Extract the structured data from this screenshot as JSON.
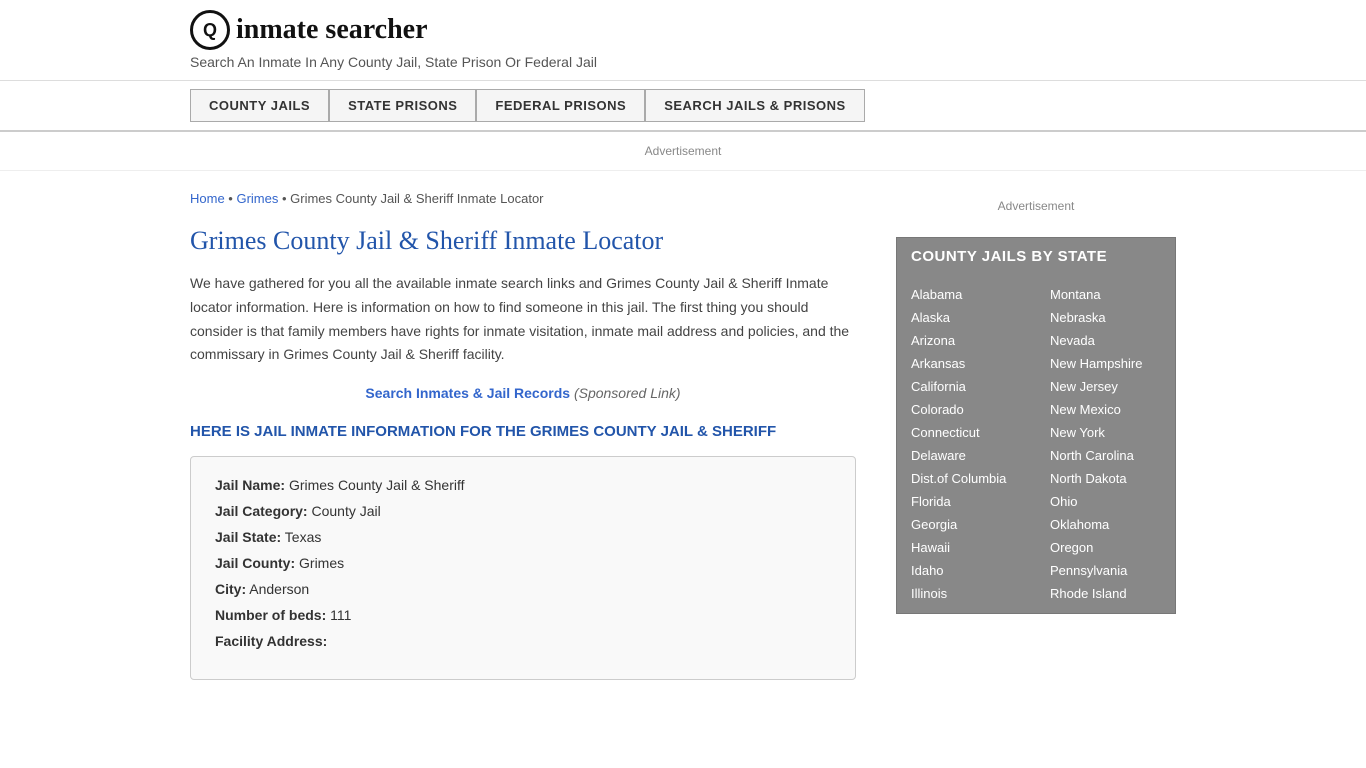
{
  "header": {
    "logo_icon": "🔍",
    "logo_text": "inmate searcher",
    "logo_prefix": "Q",
    "tagline": "Search An Inmate In Any County Jail, State Prison Or Federal Jail"
  },
  "nav": {
    "buttons": [
      {
        "label": "COUNTY JAILS",
        "name": "county-jails-nav"
      },
      {
        "label": "STATE PRISONS",
        "name": "state-prisons-nav"
      },
      {
        "label": "FEDERAL PRISONS",
        "name": "federal-prisons-nav"
      },
      {
        "label": "SEARCH JAILS & PRISONS",
        "name": "search-jails-nav"
      }
    ]
  },
  "ad_top": "Advertisement",
  "breadcrumb": {
    "home": "Home",
    "grimes": "Grimes",
    "current": "Grimes County Jail & Sheriff Inmate Locator"
  },
  "page_title": "Grimes County Jail & Sheriff Inmate Locator",
  "description": "We have gathered for you all the available inmate search links and Grimes County Jail & Sheriff Inmate locator information. Here is information on how to find someone in this jail. The first thing you should consider is that family members have rights for inmate visitation, inmate mail address and policies, and the commissary in Grimes County Jail & Sheriff facility.",
  "search_link": {
    "text": "Search Inmates & Jail Records",
    "sponsored": "(Sponsored Link)"
  },
  "jail_info_heading": "HERE IS JAIL INMATE INFORMATION FOR THE GRIMES COUNTY JAIL & SHERIFF",
  "jail_info": {
    "name_label": "Jail Name:",
    "name_value": "Grimes County Jail & Sheriff",
    "category_label": "Jail Category:",
    "category_value": "County Jail",
    "state_label": "Jail State:",
    "state_value": "Texas",
    "county_label": "Jail County:",
    "county_value": "Grimes",
    "city_label": "City:",
    "city_value": "Anderson",
    "beds_label": "Number of beds:",
    "beds_value": "111",
    "address_label": "Facility Address:"
  },
  "sidebar": {
    "ad_label": "Advertisement",
    "state_box_title": "COUNTY JAILS BY STATE",
    "states_left": [
      "Alabama",
      "Alaska",
      "Arizona",
      "Arkansas",
      "California",
      "Colorado",
      "Connecticut",
      "Delaware",
      "Dist.of Columbia",
      "Florida",
      "Georgia",
      "Hawaii",
      "Idaho",
      "Illinois"
    ],
    "states_right": [
      "Montana",
      "Nebraska",
      "Nevada",
      "New Hampshire",
      "New Jersey",
      "New Mexico",
      "New York",
      "North Carolina",
      "North Dakota",
      "Ohio",
      "Oklahoma",
      "Oregon",
      "Pennsylvania",
      "Rhode Island"
    ]
  }
}
